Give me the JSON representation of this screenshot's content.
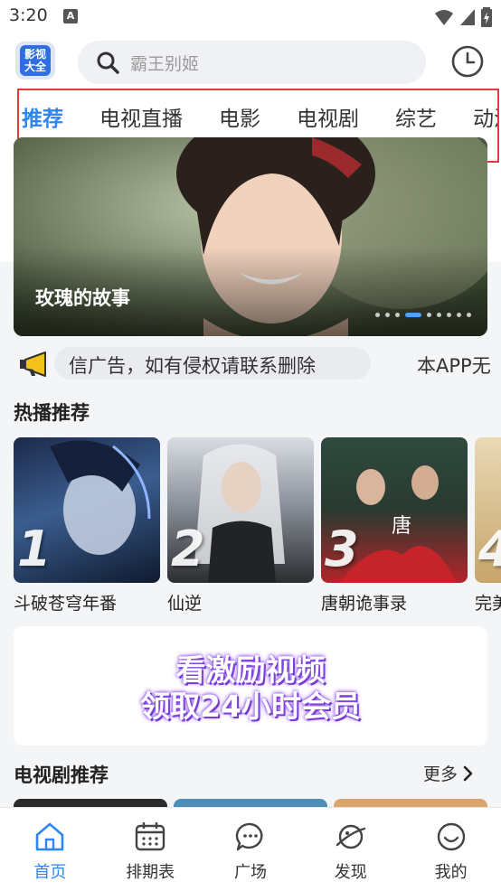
{
  "status_bar": {
    "time": "3:20",
    "notification_glyph": "A"
  },
  "header": {
    "logo_lines": [
      "影视",
      "大全"
    ],
    "search_placeholder": "霸王别姬",
    "history_icon": "clock-icon"
  },
  "tabs": [
    {
      "label": "推荐",
      "active": true
    },
    {
      "label": "电视直播",
      "active": false
    },
    {
      "label": "电影",
      "active": false
    },
    {
      "label": "电视剧",
      "active": false
    },
    {
      "label": "综艺",
      "active": false
    },
    {
      "label": "动漫",
      "active": false
    }
  ],
  "banner": {
    "title": "玫瑰的故事",
    "dot_count": 9,
    "active_dot_index": 3
  },
  "notice": {
    "icon": "megaphone-icon",
    "text": "信广告，如有侵权请联系删除",
    "text_2": "本APP无"
  },
  "hot_section": {
    "title": "热播推荐",
    "items": [
      {
        "rank": "1",
        "name": "斗破苍穹年番"
      },
      {
        "rank": "2",
        "name": "仙逆"
      },
      {
        "rank": "3",
        "name": "唐朝诡事录"
      },
      {
        "rank": "4",
        "name": "完美"
      }
    ]
  },
  "promo": {
    "line1": "看激励视频",
    "line2": "领取24小时会员"
  },
  "tv_section": {
    "title": "电视剧推荐",
    "more_label": "更多"
  },
  "bottom_nav": [
    {
      "label": "首页",
      "icon": "home-icon",
      "active": true
    },
    {
      "label": "排期表",
      "icon": "calendar-icon",
      "active": false
    },
    {
      "label": "广场",
      "icon": "chat-icon",
      "active": false
    },
    {
      "label": "发现",
      "icon": "planet-icon",
      "active": false
    },
    {
      "label": "我的",
      "icon": "smile-icon",
      "active": false
    }
  ],
  "colors": {
    "accent": "#2f86f0",
    "highlight_frame": "#e23b3b",
    "background": "#f4f5f7"
  }
}
